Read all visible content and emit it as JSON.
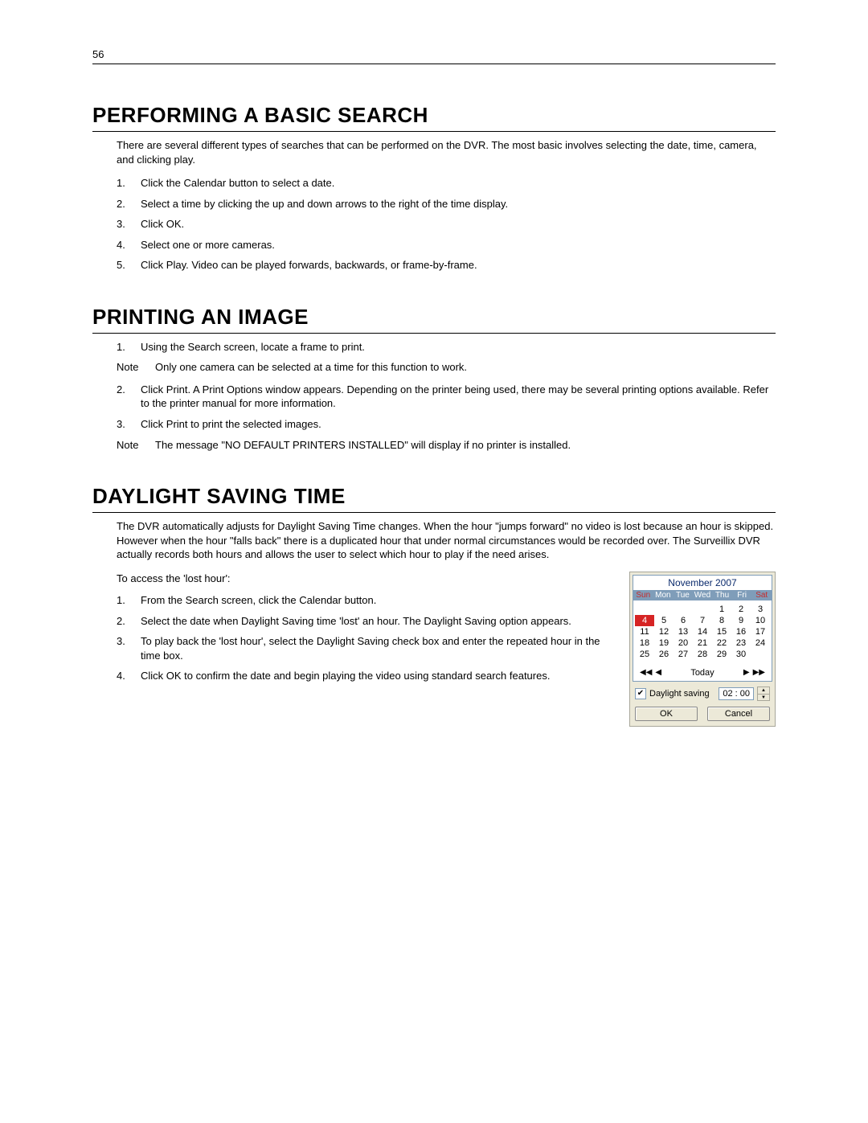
{
  "page_number": "56",
  "section1": {
    "title": "PERFORMING A BASIC SEARCH",
    "intro": "There are several different types of searches that can be performed on the DVR. The most basic involves selecting the date, time, camera, and clicking play.",
    "steps": [
      "Click the Calendar button to select a date.",
      "Select a time by clicking the up and down arrows to the right of the time display.",
      "Click OK.",
      "Select one or more cameras.",
      "Click Play.  Video can be played forwards, backwards, or frame-by-frame."
    ]
  },
  "section2": {
    "title": "PRINTING AN IMAGE",
    "step1": "Using the Search screen, locate a frame to print.",
    "note1_label": "Note",
    "note1_text": "Only one camera can be selected at a time for this function to work.",
    "step2": "Click Print.  A Print Options window appears.  Depending on the printer being used, there may be several printing options available.  Refer to the printer manual for more information.",
    "step3": "Click Print to print the selected images.",
    "note2_label": "Note",
    "note2_text": "The message \"NO DEFAULT PRINTERS INSTALLED\" will display if no printer is installed."
  },
  "section3": {
    "title": "DAYLIGHT SAVING TIME",
    "intro": "The DVR automatically adjusts for Daylight Saving Time changes.  When the hour \"jumps forward\" no video is lost because an hour is skipped.  However when the hour \"falls back\" there is a duplicated hour that under normal circumstances would be recorded over.  The Surveillix DVR actually records both hours and allows the user to select which hour to play if the need arises.",
    "access": "To access the 'lost hour':",
    "steps": [
      "From the Search screen, click the Calendar button.",
      "Select the date when Daylight Saving time 'lost' an hour. The Daylight Saving option appears.",
      "To play back the 'lost hour', select the Daylight Saving check box and enter the repeated hour in the time box.",
      "Click OK to confirm the date and begin playing the video using standard search features."
    ]
  },
  "calendar": {
    "month": "November 2007",
    "days": [
      "Sun",
      "Mon",
      "Tue",
      "Wed",
      "Thu",
      "Fri",
      "Sat"
    ],
    "weeks": [
      [
        "",
        "",
        "",
        "",
        "1",
        "2",
        "3"
      ],
      [
        "4",
        "5",
        "6",
        "7",
        "8",
        "9",
        "10"
      ],
      [
        "11",
        "12",
        "13",
        "14",
        "15",
        "16",
        "17"
      ],
      [
        "18",
        "19",
        "20",
        "21",
        "22",
        "23",
        "24"
      ],
      [
        "25",
        "26",
        "27",
        "28",
        "29",
        "30",
        ""
      ]
    ],
    "selected": "4",
    "today_label": "Today",
    "daylight_label": "Daylight saving",
    "time_value": "02 : 00",
    "ok": "OK",
    "cancel": "Cancel"
  }
}
